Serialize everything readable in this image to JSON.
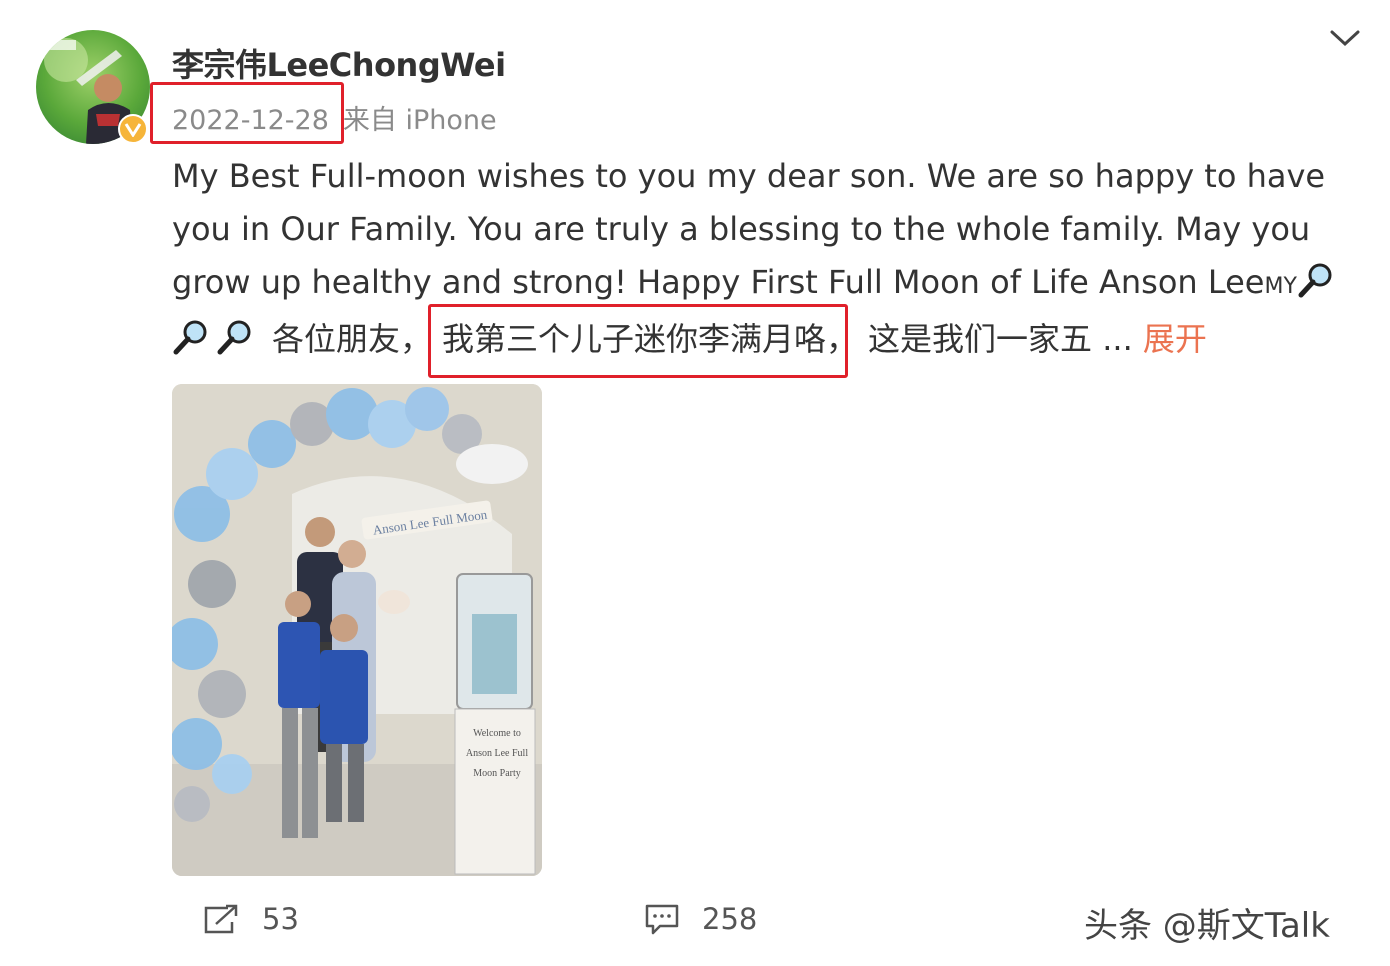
{
  "post": {
    "username": "李宗伟LeeChongWei",
    "date": "2022-12-28",
    "source": "来自 iPhone",
    "text_lines": [
      "My Best Full-moon wishes to you my dear son. We are so happy to have",
      "you in Our Family. You are truly a blessing to the whole family. May you",
      "grow up healthy and strong! Happy First Full Moon of Life Anson Lee"
    ],
    "text_line3_suffix": "MY",
    "text_line4_a": "各位朋友，",
    "text_line4_b": "我第三个儿子迷你李满月咯，",
    "text_line4_c": "这是我们一家五",
    "ellipsis": " ... ",
    "expand_label": "展开",
    "photo_banner": "Anson Lee Full Moon",
    "photo_sign": "Welcome to Anson Lee Full Moon Party"
  },
  "actions": {
    "repost_count": "53",
    "comment_count": "258"
  },
  "watermark": "头条 @斯文Talk",
  "colors": {
    "highlight_box": "#e0202a",
    "expand_link": "#eb7350",
    "meta_text": "#8a8a8a"
  },
  "icons": [
    "verified-badge-icon",
    "chevron-down-icon",
    "magnifier-key-icon",
    "repost-icon",
    "comment-icon"
  ]
}
